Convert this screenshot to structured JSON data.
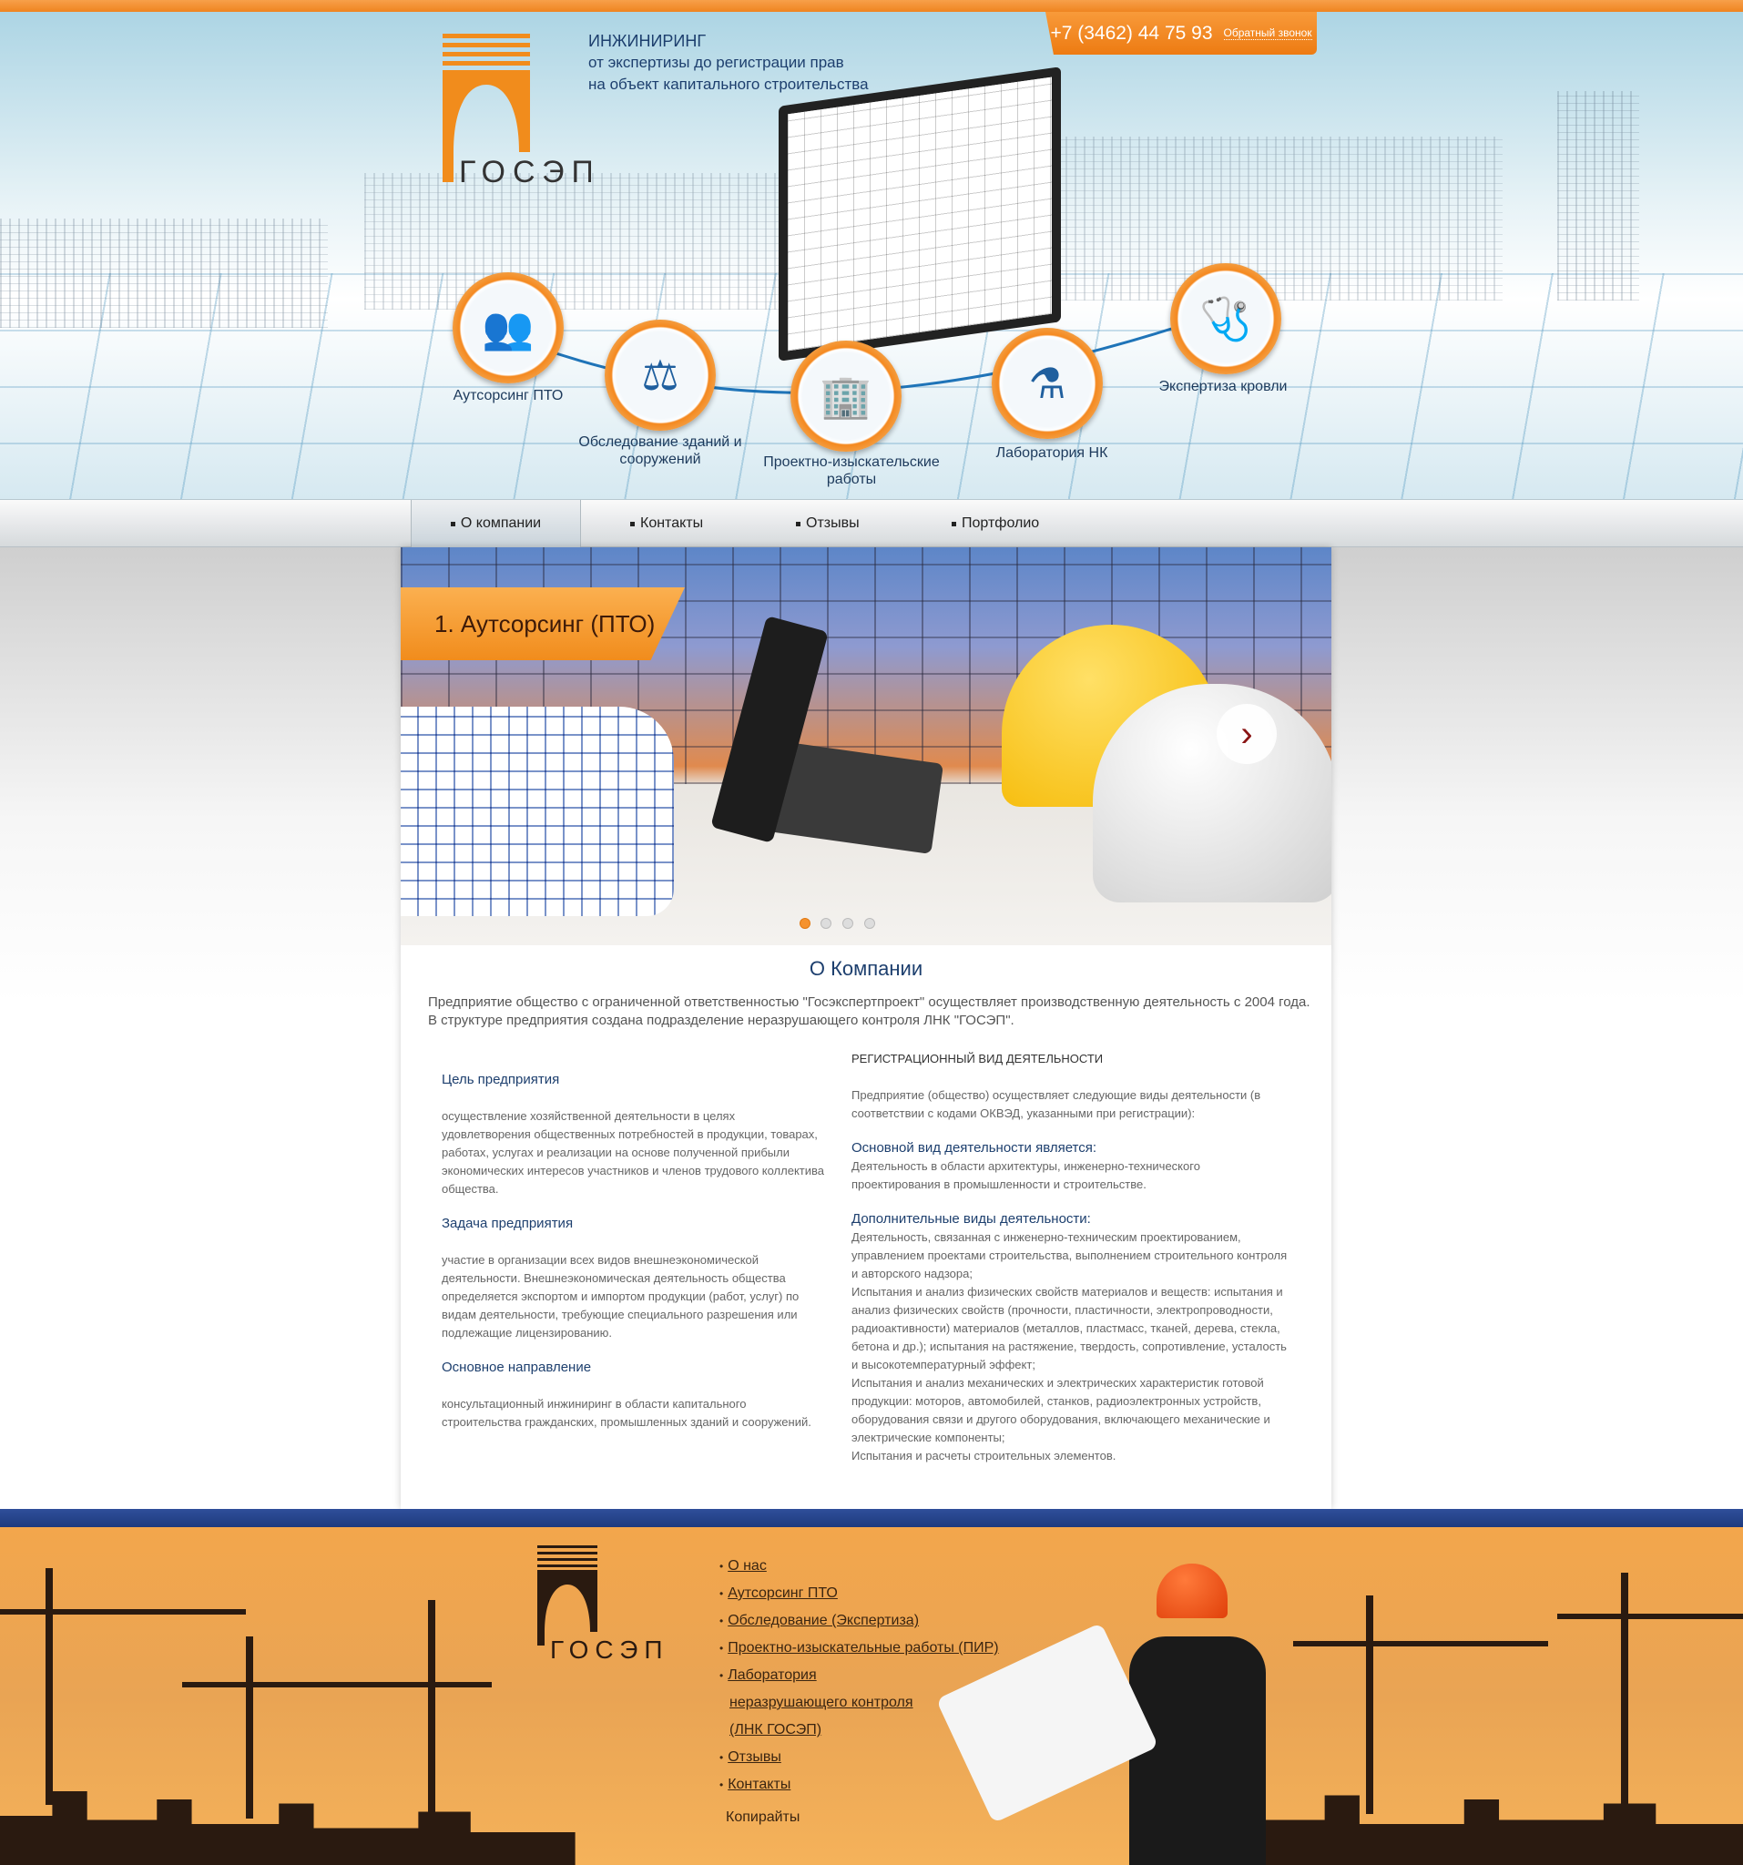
{
  "header": {
    "logo_text": "ГОСЭП",
    "tagline": [
      "ИНЖИНИРИНГ",
      "от экспертизы до регистрации прав",
      "на объект капитального строительства"
    ],
    "phone": "+7 (3462) 44 75 93",
    "callback_label": "Обратный звонок",
    "services": [
      {
        "label": "Аутсорсинг ПТО",
        "icon": "business-people-icon"
      },
      {
        "label": "Обследование зданий и сооружений",
        "icon": "scales-icon"
      },
      {
        "label": "Проектно-изыскательские работы",
        "icon": "building-icon"
      },
      {
        "label": "Лаборатория НК",
        "icon": "lab-flask-icon"
      },
      {
        "label": "Экспертиза кровли",
        "icon": "stethoscope-icon"
      }
    ]
  },
  "nav": {
    "items": [
      {
        "label": "О компании",
        "active": true
      },
      {
        "label": "Контакты"
      },
      {
        "label": "Отзывы"
      },
      {
        "label": "Портфолио"
      }
    ]
  },
  "slider": {
    "title": "1. Аутсорсинг (ПТО)",
    "slide_count": 4,
    "active_slide": 1
  },
  "about": {
    "title": "О Компании",
    "intro": [
      "Предприятие общество с ограниченной ответственностью \"Госэкспертпроект\" осуществляет производственную деятельность с 2004 года.",
      "В структуре предприятия создана подразделение неразрушающего контроля ЛНК \"ГОСЭП\"."
    ],
    "left": [
      {
        "heading": "Цель предприятия",
        "text": "осуществление хозяйственной деятельности в целях удовлетворения общественных потребностей в продукции, товарах, работах, услугах и реализации на основе полученной прибыли экономических интересов участников и членов трудового коллектива общества."
      },
      {
        "heading": "Задача предприятия",
        "text": "участие в организации всех видов внешнеэкономической деятельности. Внешнеэкономическая деятельность общества определяется экспортом и импортом продукции (работ, услуг) по видам деятельности, требующие специального разрешения или подлежащие лицензированию."
      },
      {
        "heading": "Основное направление",
        "text": "консультационный инжиниринг в области капитального строительства гражданских, промышленных зданий и сооружений."
      }
    ],
    "right": {
      "heading": "РЕГИСТРАЦИОННЫЙ ВИД ДЕЯТЕЛЬНОСТИ",
      "intro": "Предприятие (общество) осуществляет следующие виды деятельности (в соответствии с кодами ОКВЭД, указанными при регистрации):",
      "main_heading": "Основной вид деятельности является:",
      "main_text": "Деятельность в области архитектуры, инженерно-технического проектирования в промышленности и строительстве.",
      "extra_heading": "Дополнительные виды деятельности:",
      "extra_items": [
        "Деятельность, связанная с инженерно-техническим проектированием, управлением проектами строительства, выполнением строительного контроля и авторского надзора;",
        "Испытания и анализ физических свойств материалов и веществ: испытания и анализ физических свойств (прочности, пластичности, электропроводности, радиоактивности) материалов (металлов, пластмасс, тканей, дерева, стекла, бетона и др.); испытания на растяжение, твердость, сопротивление, усталость и высокотемпературный эффект;",
        "Испытания и анализ механических и электрических характеристик готовой продукции: моторов, автомобилей, станков, радиоэлектронных устройств, оборудования связи и другого оборудования, включающего механические и электрические компоненты;",
        "Испытания и расчеты строительных элементов."
      ]
    }
  },
  "footer": {
    "logo_text": "ГОСЭП",
    "links": [
      "О нас",
      "Аутсорсинг ПТО",
      "Обследование (Экспертиза)",
      "Проектно-изыскательные работы (ПИР)",
      "Лаборатория неразрушающего контроля (ЛНК ГОСЭП)",
      "Отзывы",
      "Контакты"
    ],
    "copyright": "Копирайты"
  },
  "colors": {
    "accent": "#f18c1c",
    "brand_blue": "#1d3f6e",
    "band": "#2f4f9a"
  }
}
